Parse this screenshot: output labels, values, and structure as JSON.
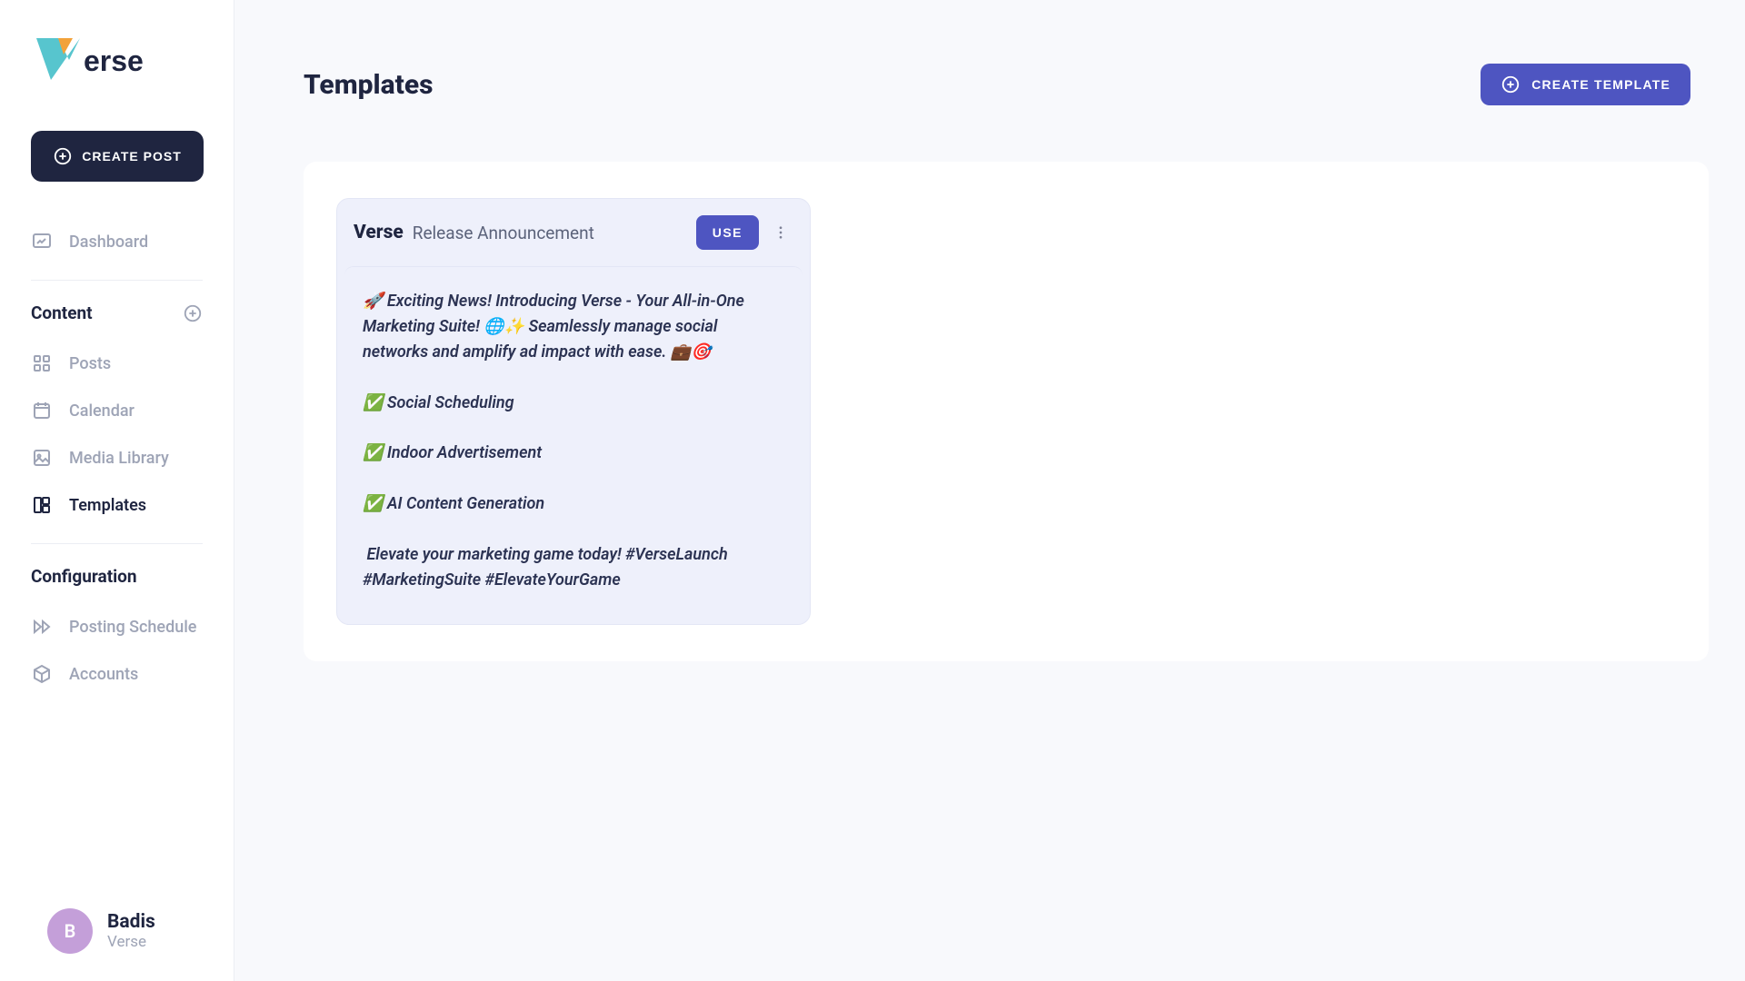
{
  "brand": {
    "name": "Verse"
  },
  "sidebar": {
    "create_post_label": "CREATE POST",
    "items": {
      "dashboard": "Dashboard"
    },
    "content_section": {
      "title": "Content",
      "items": {
        "posts": "Posts",
        "calendar": "Calendar",
        "media_library": "Media Library",
        "templates": "Templates"
      }
    },
    "config_section": {
      "title": "Configuration",
      "items": {
        "posting_schedule": "Posting Schedule",
        "accounts": "Accounts"
      }
    },
    "user": {
      "initial": "B",
      "name": "Badis",
      "org": "Verse"
    }
  },
  "page": {
    "title": "Templates",
    "create_template_label": "CREATE TEMPLATE"
  },
  "template": {
    "brand": "Verse",
    "subtitle": "Release Announcement",
    "use_label": "USE",
    "body": "🚀 Exciting News! Introducing Verse - Your All-in-One Marketing Suite! 🌐✨ Seamlessly manage social networks and amplify ad impact with ease. 💼🎯\n\n✅ Social Scheduling\n\n✅ Indoor Advertisement\n\n✅ AI Content Generation\n\n Elevate your marketing game today! #VerseLaunch #MarketingSuite #ElevateYourGame"
  }
}
